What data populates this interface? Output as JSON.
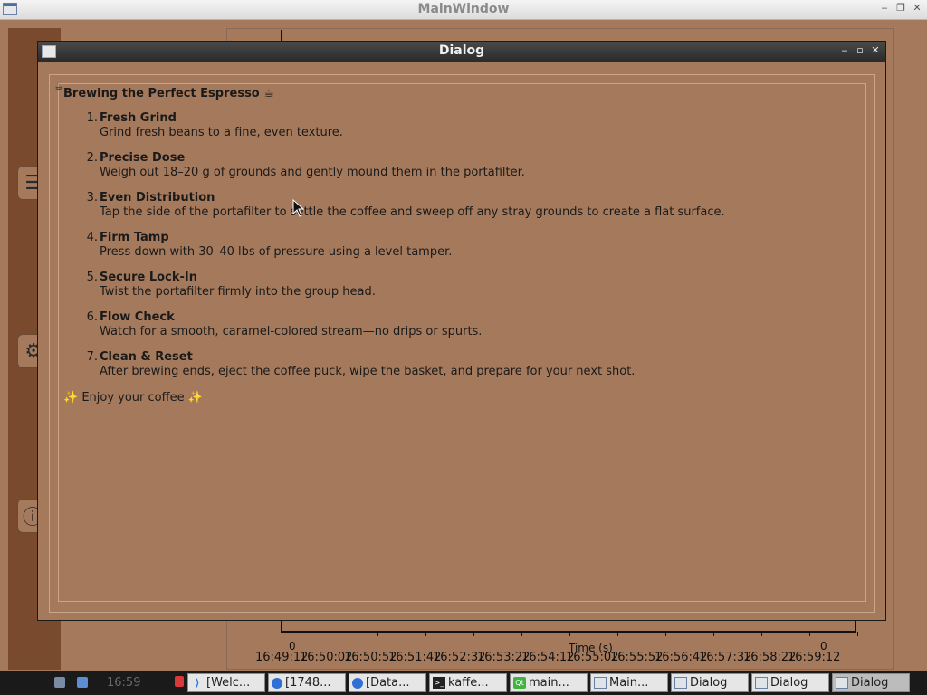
{
  "main_window": {
    "title": "MainWindow",
    "controls": {
      "minimize": "‒",
      "restore": "❐",
      "close": "✕"
    },
    "sidebar_icons": [
      "menu-icon",
      "gear-icon",
      "info-icon"
    ],
    "plot": {
      "zero_left": "0",
      "zero_right": "0",
      "x_axis_title": "Time (s)",
      "time_ticks": [
        "16:49:12",
        "16:50:02",
        "16:50:52",
        "16:51:42",
        "16:52:32",
        "16:53:22",
        "16:54:12",
        "16:55:02",
        "16:55:52",
        "16:56:42",
        "16:57:32",
        "16:58:22",
        "16:59:12"
      ]
    }
  },
  "dialog": {
    "title": "Dialog",
    "controls": {
      "minimize": "‒",
      "maximize": "▫",
      "close": "✕"
    },
    "heading": "Brewing the Perfect Espresso ☕",
    "steps": [
      {
        "num": "1.",
        "title": "Fresh Grind",
        "desc": "Grind fresh beans to a fine, even texture."
      },
      {
        "num": "2.",
        "title": "Precise Dose",
        "desc": "Weigh out 18–20 g of grounds and gently mound them in the portafilter."
      },
      {
        "num": "3.",
        "title": "Even Distribution",
        "desc": "Tap the side of the portafilter to settle the coffee and sweep off any stray grounds to create a flat surface."
      },
      {
        "num": "4.",
        "title": "Firm Tamp",
        "desc": "Press down with 30–40 lbs of pressure using a level tamper."
      },
      {
        "num": "5.",
        "title": "Secure Lock-In",
        "desc": "Twist the portafilter firmly into the group head."
      },
      {
        "num": "6.",
        "title": "Flow Check",
        "desc": "Watch for a smooth, caramel-colored stream—no drips or spurts."
      },
      {
        "num": "7.",
        "title": "Clean & Reset",
        "desc": "After brewing ends, eject the coffee puck, wipe the basket, and prepare for your next shot."
      }
    ],
    "footer": "✨ Enjoy your coffee ✨"
  },
  "taskbar": {
    "clock": "16:59",
    "tasks": [
      {
        "label": "[Welc...",
        "icon": "vscode-icon"
      },
      {
        "label": "[1748...",
        "icon": "chrome-icon"
      },
      {
        "label": "[Data...",
        "icon": "chrome-icon"
      },
      {
        "label": "kaffe...",
        "icon": "terminal-icon"
      },
      {
        "label": "main...",
        "icon": "qt-icon"
      },
      {
        "label": "Main...",
        "icon": "window-icon"
      },
      {
        "label": "Dialog",
        "icon": "window-icon"
      },
      {
        "label": "Dialog",
        "icon": "window-icon"
      },
      {
        "label": "Dialog",
        "icon": "window-icon"
      }
    ]
  },
  "colors": {
    "background": "#a57a5c",
    "sidebar": "#7a4a2e",
    "dialog_titlebar": "#2e2e2e",
    "taskbar": "#1a1a1a"
  }
}
